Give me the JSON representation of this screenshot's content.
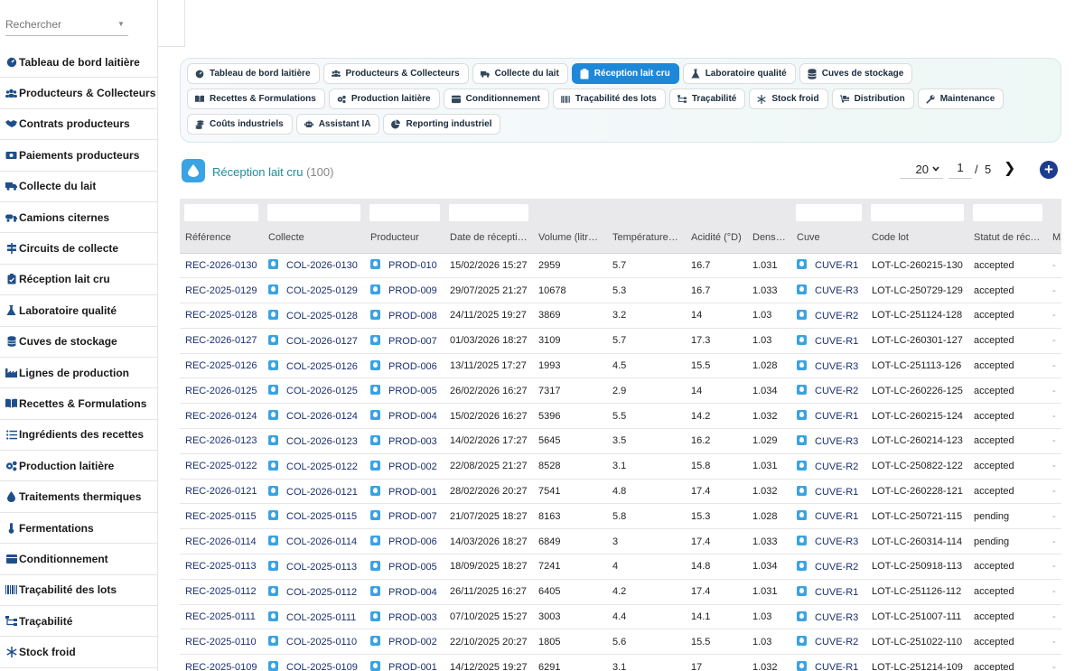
{
  "search": {
    "placeholder": "Rechercher"
  },
  "sidebar": {
    "items": [
      {
        "label": "Tableau de bord laitière",
        "icon": "dashboard-icon"
      },
      {
        "label": "Producteurs & Collecteurs",
        "icon": "users-icon"
      },
      {
        "label": "Contrats producteurs",
        "icon": "handshake-icon"
      },
      {
        "label": "Paiements producteurs",
        "icon": "money-icon"
      },
      {
        "label": "Collecte du lait",
        "icon": "truck-icon"
      },
      {
        "label": "Camions citernes",
        "icon": "tanker-truck-icon"
      },
      {
        "label": "Circuits de collecte",
        "icon": "signpost-icon"
      },
      {
        "label": "Réception lait cru",
        "icon": "clipboard-icon"
      },
      {
        "label": "Laboratoire qualité",
        "icon": "flask-icon"
      },
      {
        "label": "Cuves de stockage",
        "icon": "database-icon"
      },
      {
        "label": "Lignes de production",
        "icon": "industry-icon"
      },
      {
        "label": "Recettes & Formulations",
        "icon": "book-icon"
      },
      {
        "label": "Ingrédients des recettes",
        "icon": "list-icon"
      },
      {
        "label": "Production laitière",
        "icon": "gears-icon"
      },
      {
        "label": "Traitements thermiques",
        "icon": "droplet-icon"
      },
      {
        "label": "Fermentations",
        "icon": "thermometer-icon"
      },
      {
        "label": "Conditionnement",
        "icon": "box-icon"
      },
      {
        "label": "Traçabilité des lots",
        "icon": "barcode-icon"
      },
      {
        "label": "Traçabilité",
        "icon": "sitemap-icon"
      },
      {
        "label": "Stock froid",
        "icon": "snowflake-icon"
      }
    ]
  },
  "tabs": [
    {
      "label": "Tableau de bord laitière",
      "icon": "dashboard-icon",
      "active": false
    },
    {
      "label": "Producteurs & Collecteurs",
      "icon": "users-icon",
      "active": false
    },
    {
      "label": "Collecte du lait",
      "icon": "truck-icon",
      "active": false
    },
    {
      "label": "Réception lait cru",
      "icon": "clipboard-icon",
      "active": true
    },
    {
      "label": "Laboratoire qualité",
      "icon": "flask-icon",
      "active": false
    },
    {
      "label": "Cuves de stockage",
      "icon": "database-icon",
      "active": false
    },
    {
      "label": "Recettes & Formulations",
      "icon": "book-icon",
      "active": false
    },
    {
      "label": "Production laitière",
      "icon": "gears-icon",
      "active": false
    },
    {
      "label": "Conditionnement",
      "icon": "box-icon",
      "active": false
    },
    {
      "label": "Traçabilité des lots",
      "icon": "barcode-icon",
      "active": false
    },
    {
      "label": "Traçabilité",
      "icon": "sitemap-icon",
      "active": false
    },
    {
      "label": "Stock froid",
      "icon": "snowflake-icon",
      "active": false
    },
    {
      "label": "Distribution",
      "icon": "dolly-icon",
      "active": false
    },
    {
      "label": "Maintenance",
      "icon": "wrench-icon",
      "active": false
    },
    {
      "label": "Coûts industriels",
      "icon": "coins-icon",
      "active": false
    },
    {
      "label": "Assistant IA",
      "icon": "robot-icon",
      "active": false
    },
    {
      "label": "Reporting industriel",
      "icon": "pie-chart-icon",
      "active": false
    }
  ],
  "list": {
    "title": "Réception lait cru",
    "count": "(100)",
    "page_size": "20",
    "page": "1",
    "page_sep": "/",
    "total_pages": "5",
    "next_label": "❯",
    "add_label": "+"
  },
  "table": {
    "columns": [
      "Référence",
      "Collecte",
      "Producteur",
      "Date de réception",
      "Volume (litres)",
      "Température (°C)",
      "Acidité (°D)",
      "Densité",
      "Cuve",
      "Code lot",
      "Statut de réception",
      "M"
    ],
    "rows": [
      [
        "REC-2026-0130",
        "COL-2026-0130",
        "PROD-010",
        "15/02/2026 15:27",
        "2959",
        "5.7",
        "16.7",
        "1.031",
        "CUVE-R1",
        "LOT-LC-260215-130",
        "accepted",
        "-"
      ],
      [
        "REC-2025-0129",
        "COL-2025-0129",
        "PROD-009",
        "29/07/2025 21:27",
        "10678",
        "5.3",
        "16.7",
        "1.033",
        "CUVE-R3",
        "LOT-LC-250729-129",
        "accepted",
        "-"
      ],
      [
        "REC-2025-0128",
        "COL-2025-0128",
        "PROD-008",
        "24/11/2025 19:27",
        "3869",
        "3.2",
        "14",
        "1.03",
        "CUVE-R2",
        "LOT-LC-251124-128",
        "accepted",
        "-"
      ],
      [
        "REC-2026-0127",
        "COL-2026-0127",
        "PROD-007",
        "01/03/2026 18:27",
        "3109",
        "5.7",
        "17.3",
        "1.03",
        "CUVE-R1",
        "LOT-LC-260301-127",
        "accepted",
        "-"
      ],
      [
        "REC-2025-0126",
        "COL-2025-0126",
        "PROD-006",
        "13/11/2025 17:27",
        "1993",
        "4.5",
        "15.5",
        "1.028",
        "CUVE-R3",
        "LOT-LC-251113-126",
        "accepted",
        "-"
      ],
      [
        "REC-2026-0125",
        "COL-2026-0125",
        "PROD-005",
        "26/02/2026 16:27",
        "7317",
        "2.9",
        "14",
        "1.034",
        "CUVE-R2",
        "LOT-LC-260226-125",
        "accepted",
        "-"
      ],
      [
        "REC-2026-0124",
        "COL-2026-0124",
        "PROD-004",
        "15/02/2026 16:27",
        "5396",
        "5.5",
        "14.2",
        "1.032",
        "CUVE-R1",
        "LOT-LC-260215-124",
        "accepted",
        "-"
      ],
      [
        "REC-2026-0123",
        "COL-2026-0123",
        "PROD-003",
        "14/02/2026 17:27",
        "5645",
        "3.5",
        "16.2",
        "1.029",
        "CUVE-R3",
        "LOT-LC-260214-123",
        "accepted",
        "-"
      ],
      [
        "REC-2025-0122",
        "COL-2025-0122",
        "PROD-002",
        "22/08/2025 21:27",
        "8528",
        "3.1",
        "15.8",
        "1.031",
        "CUVE-R2",
        "LOT-LC-250822-122",
        "accepted",
        "-"
      ],
      [
        "REC-2026-0121",
        "COL-2026-0121",
        "PROD-001",
        "28/02/2026 20:27",
        "7541",
        "4.8",
        "17.4",
        "1.032",
        "CUVE-R1",
        "LOT-LC-260228-121",
        "accepted",
        "-"
      ],
      [
        "REC-2025-0115",
        "COL-2025-0115",
        "PROD-007",
        "21/07/2025 18:27",
        "8163",
        "5.8",
        "15.3",
        "1.028",
        "CUVE-R1",
        "LOT-LC-250721-115",
        "pending",
        "-"
      ],
      [
        "REC-2026-0114",
        "COL-2026-0114",
        "PROD-006",
        "14/03/2026 18:27",
        "6849",
        "3",
        "17.4",
        "1.033",
        "CUVE-R3",
        "LOT-LC-260314-114",
        "pending",
        "-"
      ],
      [
        "REC-2025-0113",
        "COL-2025-0113",
        "PROD-005",
        "18/09/2025 18:27",
        "7241",
        "4",
        "14.8",
        "1.034",
        "CUVE-R2",
        "LOT-LC-250918-113",
        "accepted",
        "-"
      ],
      [
        "REC-2025-0112",
        "COL-2025-0112",
        "PROD-004",
        "26/11/2025 16:27",
        "6405",
        "4.2",
        "17.4",
        "1.031",
        "CUVE-R1",
        "LOT-LC-251126-112",
        "accepted",
        "-"
      ],
      [
        "REC-2025-0111",
        "COL-2025-0111",
        "PROD-003",
        "07/10/2025 15:27",
        "3003",
        "4.4",
        "14.1",
        "1.03",
        "CUVE-R3",
        "LOT-LC-251007-111",
        "accepted",
        "-"
      ],
      [
        "REC-2025-0110",
        "COL-2025-0110",
        "PROD-002",
        "22/10/2025 20:27",
        "1805",
        "5.6",
        "15.5",
        "1.03",
        "CUVE-R2",
        "LOT-LC-251022-110",
        "accepted",
        "-"
      ],
      [
        "REC-2025-0109",
        "COL-2025-0109",
        "PROD-001",
        "14/12/2025 19:27",
        "6291",
        "3.1",
        "17",
        "1.032",
        "CUVE-R1",
        "LOT-LC-251214-109",
        "accepted",
        "-"
      ]
    ]
  },
  "colors": {
    "accent": "#1e88d8",
    "link": "#1a2f6e",
    "title": "#1c8f9a",
    "cuve_icon": "#3aa3e4",
    "add_button": "#1d3b8f"
  }
}
